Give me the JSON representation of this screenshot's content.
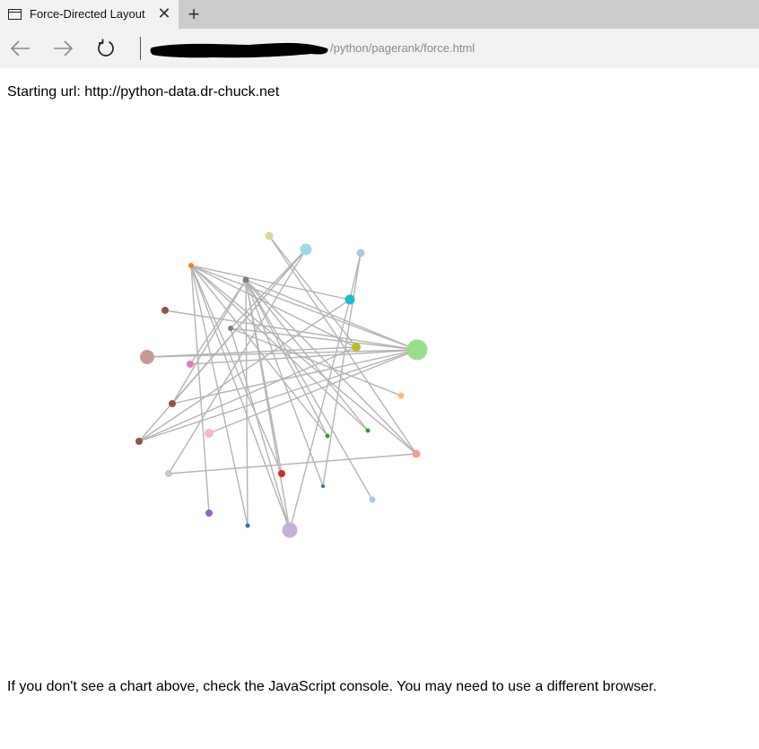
{
  "browser": {
    "tab": {
      "title": "Force-Directed Layout",
      "close_glyph": "✕"
    },
    "new_tab_glyph": "+",
    "address": {
      "url_visible": "/python/pagerank/force.html"
    }
  },
  "page": {
    "starting_url": "Starting url: http://python-data.dr-chuck.net",
    "footer": "If you don't see a chart above, check the JavaScript console. You may need to use a different browser."
  },
  "chart_data": {
    "type": "force-directed-graph",
    "nodes": [
      {
        "id": 0,
        "color": "#ff7f0e",
        "size": 3.0
      },
      {
        "id": 1,
        "color": "#7f7f7f",
        "size": 3.5
      },
      {
        "id": 2,
        "color": "#dbdb8d",
        "size": 4.5
      },
      {
        "id": 3,
        "color": "#9edae5",
        "size": 6.5
      },
      {
        "id": 4,
        "color": "#aec7e8",
        "size": 4.5
      },
      {
        "id": 5,
        "color": "#17becf",
        "size": 5.5
      },
      {
        "id": 6,
        "color": "#8c564b",
        "size": 4.0
      },
      {
        "id": 7,
        "color": "#7f7f7f",
        "size": 3.0
      },
      {
        "id": 8,
        "color": "#bcbd22",
        "size": 5.0
      },
      {
        "id": 9,
        "color": "#98df8a",
        "size": 11.5
      },
      {
        "id": 10,
        "color": "#c49c94",
        "size": 8.0
      },
      {
        "id": 11,
        "color": "#e377c2",
        "size": 4.0
      },
      {
        "id": 12,
        "color": "#8c564b",
        "size": 4.0
      },
      {
        "id": 13,
        "color": "#ffbb78",
        "size": 3.5
      },
      {
        "id": 14,
        "color": "#2ca02c",
        "size": 2.5
      },
      {
        "id": 15,
        "color": "#2ca02c",
        "size": 2.5
      },
      {
        "id": 16,
        "color": "#8c564b",
        "size": 4.0
      },
      {
        "id": 17,
        "color": "#f7b6d2",
        "size": 5.0
      },
      {
        "id": 18,
        "color": "#ff9896",
        "size": 4.5
      },
      {
        "id": 19,
        "color": "#c7c7c7",
        "size": 4.0
      },
      {
        "id": 20,
        "color": "#d62728",
        "size": 4.0
      },
      {
        "id": 21,
        "color": "#1f77b4",
        "size": 2.0
      },
      {
        "id": 22,
        "color": "#aec7e8",
        "size": 3.5
      },
      {
        "id": 23,
        "color": "#9467bd",
        "size": 4.0
      },
      {
        "id": 24,
        "color": "#1f77b4",
        "size": 2.5
      },
      {
        "id": 25,
        "color": "#c5b0d5",
        "size": 8.5
      }
    ],
    "links": [
      [
        0,
        9
      ],
      [
        0,
        8
      ],
      [
        0,
        18
      ],
      [
        0,
        14
      ],
      [
        0,
        15
      ],
      [
        0,
        25
      ],
      [
        0,
        24
      ],
      [
        0,
        23
      ],
      [
        0,
        20
      ],
      [
        0,
        5
      ],
      [
        1,
        9
      ],
      [
        1,
        18
      ],
      [
        1,
        22
      ],
      [
        1,
        25
      ],
      [
        1,
        24
      ],
      [
        1,
        21
      ],
      [
        1,
        12
      ],
      [
        2,
        8
      ],
      [
        2,
        18
      ],
      [
        3,
        16
      ],
      [
        3,
        12
      ],
      [
        3,
        19
      ],
      [
        3,
        7
      ],
      [
        4,
        21
      ],
      [
        4,
        5
      ],
      [
        5,
        16
      ],
      [
        5,
        25
      ],
      [
        6,
        9
      ],
      [
        7,
        9
      ],
      [
        7,
        13
      ],
      [
        7,
        25
      ],
      [
        10,
        9
      ],
      [
        10,
        8
      ],
      [
        11,
        9
      ],
      [
        11,
        1
      ],
      [
        12,
        9
      ],
      [
        16,
        9
      ],
      [
        16,
        8
      ],
      [
        17,
        9
      ],
      [
        19,
        18
      ],
      [
        20,
        1
      ],
      [
        14,
        1
      ],
      [
        15,
        1
      ]
    ]
  }
}
